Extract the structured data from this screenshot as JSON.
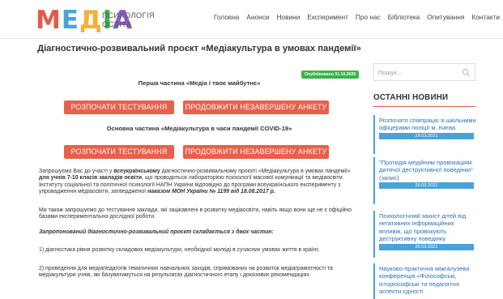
{
  "header": {
    "logo": {
      "word": "МЕДІА",
      "line1": "ПСИХОЛОГІЯ",
      "line2": "ОСВІТА"
    },
    "nav": [
      "Головна",
      "Анонси",
      "Новини",
      "Експеримент",
      "Про нас",
      "Бібліотека",
      "Опитування",
      "Контакти"
    ]
  },
  "main": {
    "title": "Діагностично-розвивальний проєкт «Медіакультура в умовах пандемії»",
    "published": "Опубліковано 31.10.2020",
    "part1_title": "Перша частина «Медіа і твоє майбутнє»",
    "part2_title": "Основна частина «Медіакультура в часи пандемії COVID-19»",
    "start_button": "РОЗПОЧАТИ ТЕСТУВАННЯ",
    "continue_button": "ПРОДОВЖИТИ НЕЗАВЕРШЕНУ АНКЕТУ",
    "p1_a": "Запрошуємо Вас до участі у ",
    "p1_b": "всеукраїнському",
    "p1_c": " діагностично-розвивальному проєкті «Медіакультура в умовах пандемії» ",
    "p1_d": "для учнів 7-10 класів закладів освіти",
    "p1_e": ", що проводиться лабораторією психології масової комунікації та медіаосвіти Інституту соціальної та політичної психології НАПН України відповідно до програми всеукраїнського експерименту з упровадження медіаосвіти, затвердженої ",
    "p1_f": "наказом МОН України № 1199 від 18.08.2017 р.",
    "p2": "Ми також запрошуємо до тестування заклади, які зацікавлені в розвитку медіаосвіти, навіть якщо вони ще не є офіційно базами експериментально-дослідної роботи.",
    "p3": "Запропонований діагностично-розвивальний проєкт складається з двох частин:",
    "p4": "1) діагностика рівня розвитку складових медіакультури, необхідної молоді в сучасних умовах життя в країні;",
    "p5": "2) проведення для медіапедагогів тематичних навчальних заходів, спрямованих на розвиток медіаграмотності та медіакультури учнів, які базуватимуться на результатах діагностичного етапу і доказових рекомендаціях"
  },
  "sidebar": {
    "search_placeholder": "Пошук ...",
    "widget_title": "ОСТАННІ НОВИНИ",
    "posts": [
      {
        "title": "Розпочато співпрацю зі шкільними офіцерами поліції м. Києва",
        "date": "29.03.2021"
      },
      {
        "title": "\"Протидія медійним провокаціям дитячої деструктивної поведінки\" (запис)",
        "date": "26.03.2021"
      },
      {
        "title": "Психологічний захист дітей від негативних інформаційних впливів, що провокують деструктивну поведінку",
        "date": "25.03.2021"
      },
      {
        "title": "Науково-практична міжгалузева конференція «Філософські, історіософські та педагогічні аспекти єдності",
        "date": ""
      }
    ]
  },
  "colors": {
    "accent_red": "#e8604c",
    "date_blue": "#4aa3d8",
    "link_blue": "#2c6fb7",
    "badge_green": "#38b44a"
  }
}
